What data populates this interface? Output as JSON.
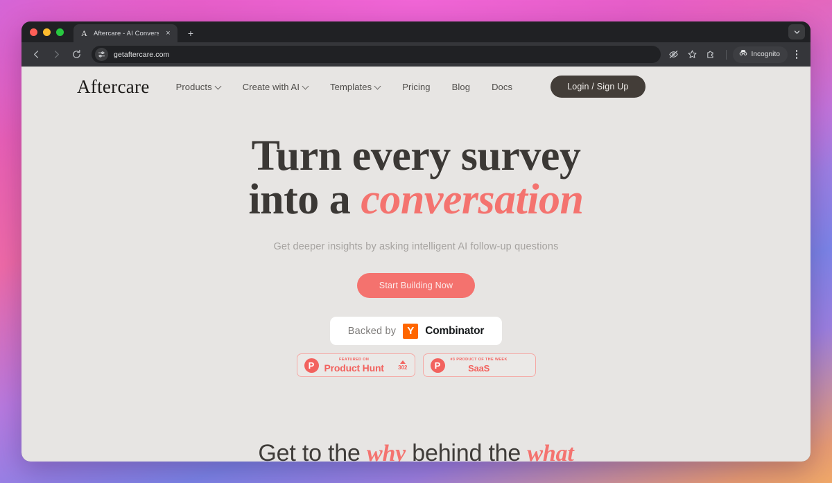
{
  "browser": {
    "tab": {
      "title": "Aftercare - AI Conversational",
      "favicon_letter": "A",
      "close_label": "×"
    },
    "new_tab_label": "+",
    "toolbar": {
      "back_icon": "back-arrow-icon",
      "forward_icon": "forward-arrow-icon",
      "reload_icon": "reload-icon",
      "url": "getaftercare.com",
      "site_settings_icon": "tune-icon",
      "tracking_protection_icon": "eye-slash-icon",
      "bookmark_icon": "star-icon",
      "extensions_icon": "puzzle-icon",
      "incognito_label": "Incognito",
      "incognito_icon": "incognito-hat-icon",
      "menu_icon": "kebab-menu-icon"
    }
  },
  "site": {
    "brand": "Aftercare",
    "nav": [
      {
        "label": "Products",
        "has_caret": true
      },
      {
        "label": "Create with AI",
        "has_caret": true
      },
      {
        "label": "Templates",
        "has_caret": true
      },
      {
        "label": "Pricing",
        "has_caret": false
      },
      {
        "label": "Blog",
        "has_caret": false
      },
      {
        "label": "Docs",
        "has_caret": false
      }
    ],
    "login_button": "Login / Sign Up"
  },
  "hero": {
    "line1": "Turn every survey",
    "line2_prefix": "into a ",
    "line2_accent": "conversation",
    "subtitle": "Get deeper insights by asking intelligent AI follow-up questions",
    "cta": "Start Building Now"
  },
  "yc_badge": {
    "prefix": "Backed by",
    "mark": "Y",
    "name": "Combinator"
  },
  "product_hunt": [
    {
      "kicker": "FEATURED ON",
      "name": "Product Hunt",
      "logo": "P",
      "votes": "302"
    },
    {
      "kicker": "#3 PRODUCT OF THE WEEK",
      "name": "SaaS",
      "logo": "P",
      "votes": ""
    }
  ],
  "section": {
    "part1": "Get to the ",
    "accent1": "why",
    "part2": " behind the ",
    "accent2": "what"
  },
  "colors": {
    "accent": "#f4736f",
    "dark": "#433d38",
    "page_bg": "#e7e5e3",
    "yc_orange": "#ff6600",
    "ph_red": "#f2625e"
  }
}
